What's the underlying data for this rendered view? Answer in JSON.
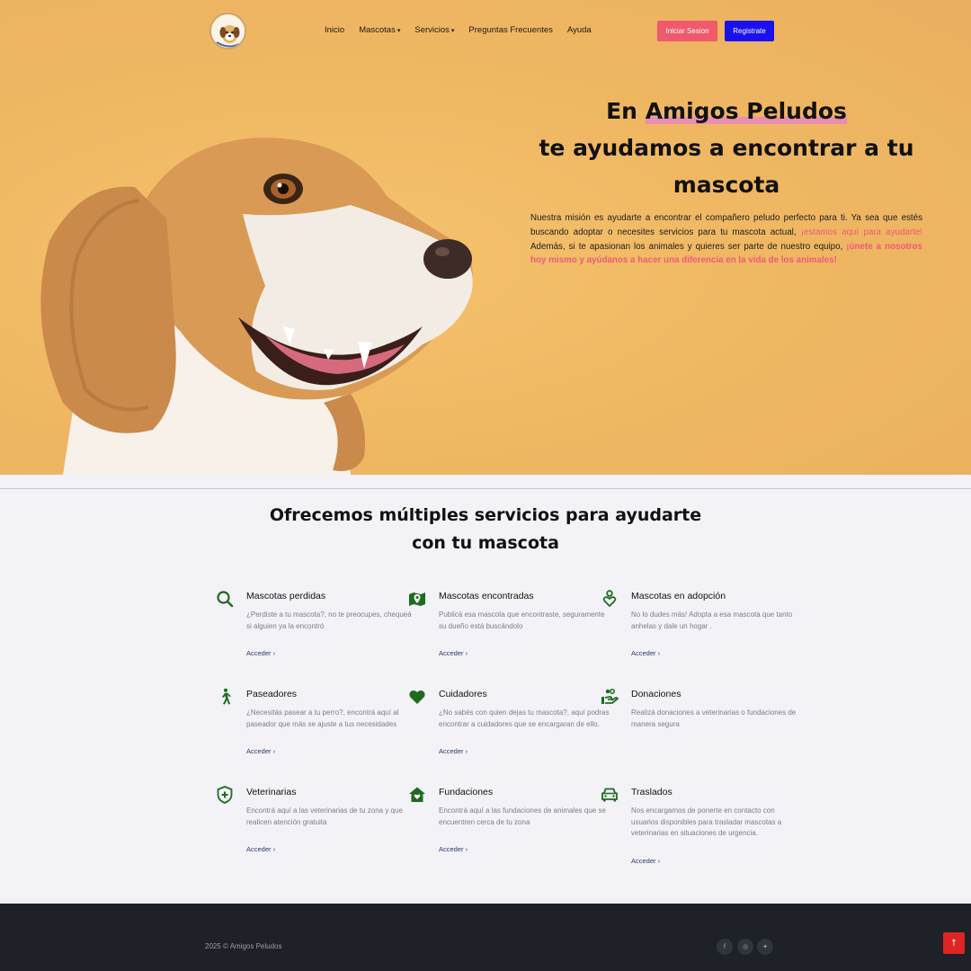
{
  "nav": {
    "logo_text": "AMIGOS PELUDOS",
    "links": [
      {
        "label": "Inicio",
        "caret": ""
      },
      {
        "label": "Mascotas",
        "caret": "▾"
      },
      {
        "label": "Servicios",
        "caret": "▾"
      },
      {
        "label": "Preguntas Frecuentes",
        "caret": ""
      },
      {
        "label": "Ayuda",
        "caret": ""
      }
    ],
    "login_label": "Iniciar Sesion",
    "register_label": "Registrate"
  },
  "hero": {
    "title_prefix": "En ",
    "title_highlight": "Amigos Peludos",
    "title_line2": "te ayudamos a encontrar a tu",
    "title_line3": "mascota",
    "text_1": "Nuestra misión es ayudarte a encontrar el compañero peludo perfecto para ti. Ya sea que estés buscando adoptar o necesites servicios para tu mascota actual, ",
    "text_pink_1": "¡estamos aquí para ayudarte!",
    "text_2": " Además, si te apasionan los animales y quieres ser parte de nuestro equipo, ",
    "text_pink_2": "¡únete a nosotros hoy mismo y ayúdanos a hacer una diferencia en la vida de los animales!"
  },
  "services": {
    "title_line1": "Ofrecemos múltiples servicios para ayudarte",
    "title_line2": "con tu mascota",
    "items": [
      {
        "title": "Mascotas perdidas",
        "desc": "¿Perdiste a tu mascota?, no te preocupes, chequeá si alguien ya la encontró",
        "link": "Acceder ›",
        "icon": "search-icon"
      },
      {
        "title": "Mascotas encontradas",
        "desc": "Publicá esa mascota que encontraste, seguramente su dueño está buscándolo",
        "link": "Acceder ›",
        "icon": "map-pin-icon"
      },
      {
        "title": "Mascotas en adopción",
        "desc": "No lo dudes más! Adopta a esa mascota que tanto anhelas y dale un hogar .",
        "link": "Acceder ›",
        "icon": "person-heart-icon"
      },
      {
        "title": "Paseadores",
        "desc": "¿Necesitás pasear a tu perro?, encontrá aquí al paseador que más se ajuste a tus necesidades",
        "link": "Acceder ›",
        "icon": "walking-icon"
      },
      {
        "title": "Cuidadores",
        "desc": "¿No sabés con quien dejas tu mascota?, aquí podras encontrar a cuidadores que se encargaran de ello.",
        "link": "Acceder ›",
        "icon": "heart-icon"
      },
      {
        "title": "Donaciones",
        "desc": "Realizá donaciones a veterinarias o fundaciones de manera segura",
        "link": "",
        "icon": "donation-icon"
      },
      {
        "title": "Veterinarias",
        "desc": "Encontrá aquí a las veterinarias de tu zona y que realicen atención gratuita",
        "link": "Acceder ›",
        "icon": "shield-plus-icon"
      },
      {
        "title": "Fundaciones",
        "desc": "Encontrá aquí a las fundaciones de animales que se encuentren cerca de tu zona",
        "link": "Acceder ›",
        "icon": "house-heart-icon"
      },
      {
        "title": "Traslados",
        "desc": "Nos encargamos de ponerte en contacto con usuarios disponibles para trasladar mascotas a veterinarias en situaciones de urgencia.",
        "link": "Acceder ›",
        "icon": "car-icon"
      }
    ]
  },
  "footer": {
    "copyright": "2025 © Amigos Peludos",
    "social": [
      {
        "name": "facebook-icon",
        "glyph": "f"
      },
      {
        "name": "instagram-icon",
        "glyph": "◎"
      },
      {
        "name": "twitter-icon",
        "glyph": "✦"
      }
    ],
    "to_top_glyph": "↑"
  },
  "colors": {
    "hero_bg": "#f0b863",
    "accent_pink": "#ef5a7b",
    "login_bg": "#ee5a6b",
    "register_bg": "#1a10ee",
    "icon_green": "#1f6b1f",
    "footer_bg": "#1e2128",
    "to_top_bg": "#e02424"
  }
}
